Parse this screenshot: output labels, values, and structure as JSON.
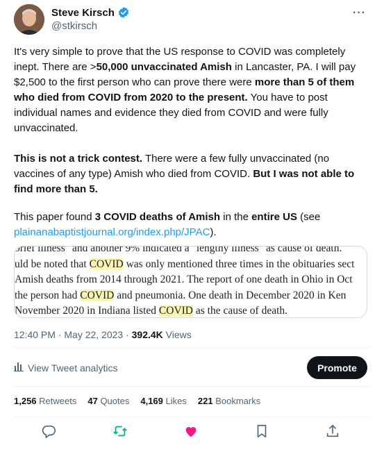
{
  "author": {
    "name": "Steve Kirsch",
    "handle": "@stkirsch"
  },
  "more_label": "···",
  "tweet": {
    "p1": [
      {
        "t": "It's very simple to prove that the US response to COVID was completely inept. There are >",
        "b": false
      },
      {
        "t": "50,000 unvaccinated Amish",
        "b": true
      },
      {
        "t": " in Lancaster, PA. I will pay $2,500 to the first person who can prove there were ",
        "b": false
      },
      {
        "t": "more than 5 of them who died from COVID from 2020 to the present.",
        "b": true
      },
      {
        "t": " You have to post individual names and evidence they died from COVID and were fully unvaccinated.",
        "b": false
      }
    ],
    "p2": [
      {
        "t": "This is not a trick contest.",
        "b": true
      },
      {
        "t": " There were a few fully unvaccinated (no vaccines of any type) Amish who died from COVID. ",
        "b": false
      },
      {
        "t": "But I was not able to find more than 5.",
        "b": true
      }
    ],
    "p3": [
      {
        "t": "This paper found ",
        "b": false
      },
      {
        "t": "3 COVID deaths of Amish",
        "b": true
      },
      {
        "t": " in the ",
        "b": false
      },
      {
        "t": "entire US",
        "b": true
      },
      {
        "t": " (see ",
        "b": false
      }
    ],
    "link": "plainanabaptistjournal.org/index.php/JPAC",
    "link_suffix": ")."
  },
  "embed_lines": [
    [
      {
        "t": "brief illness\" and another 9% indicated a \"lengthy illness\" as cause of death.",
        "h": false
      }
    ],
    [
      {
        "t": "uld be noted that ",
        "h": false
      },
      {
        "t": "COVID",
        "h": true
      },
      {
        "t": " was only mentioned three times in the obituaries sect",
        "h": false
      }
    ],
    [
      {
        "t": "Amish deaths from 2014 through 2021. The report of one death in Ohio in Oct",
        "h": false
      }
    ],
    [
      {
        "t": " the person had ",
        "h": false
      },
      {
        "t": "COVID",
        "h": true
      },
      {
        "t": " and pneumonia. One death in December 2020 in Ken",
        "h": false
      }
    ],
    [
      {
        "t": "November 2020 in Indiana listed ",
        "h": false
      },
      {
        "t": "COVID",
        "h": true
      },
      {
        "t": " as the cause of death.",
        "h": false
      }
    ]
  ],
  "meta": {
    "time": "12:40 PM · May 22, 2023 · ",
    "views_count": "392.4K",
    "views_label": " Views"
  },
  "analytics_label": "View Tweet analytics",
  "promote_label": "Promote",
  "stats": [
    {
      "count": "1,256",
      "label": " Retweets"
    },
    {
      "count": "47",
      "label": " Quotes"
    },
    {
      "count": "4,169",
      "label": " Likes"
    },
    {
      "count": "221",
      "label": " Bookmarks"
    }
  ],
  "colors": {
    "accent": "#1d9bf0",
    "retweet": "#00ba7c",
    "like": "#f91880",
    "muted": "#536471",
    "highlight": "#fbf7b3"
  },
  "icons": [
    "verified-badge-icon",
    "more-icon",
    "analytics-icon",
    "reply-icon",
    "retweet-icon",
    "like-icon",
    "bookmark-icon",
    "share-icon"
  ]
}
